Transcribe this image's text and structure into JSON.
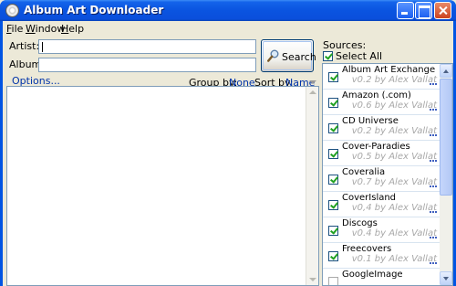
{
  "window": {
    "title": "Album Art Downloader"
  },
  "menu": {
    "file": "File",
    "window": "Window",
    "help": "Help"
  },
  "search": {
    "artist_label": "Artist:",
    "album_label": "Album:",
    "artist_value": "",
    "album_value": "",
    "button_label": "Search"
  },
  "results_bar": {
    "options_link": "Options...",
    "group_by_label": "Group by:",
    "group_by_value": "None",
    "sort_by_label": "Sort by:",
    "sort_by_value": "Name"
  },
  "sources": {
    "label": "Sources:",
    "select_all_label": "Select All",
    "select_all_checked": true,
    "items": [
      {
        "name": "Album Art Exchange",
        "version": "v0.2 by Alex Vallat",
        "checked": true
      },
      {
        "name": "Amazon (.com)",
        "version": "v0.6 by Alex Vallat",
        "checked": true
      },
      {
        "name": "CD Universe",
        "version": "v0.2 by Alex Vallat",
        "checked": true
      },
      {
        "name": "Cover-Paradies",
        "version": "v0.5 by Alex Vallat",
        "checked": true
      },
      {
        "name": "Coveralia",
        "version": "v0.7 by Alex Vallat",
        "checked": true
      },
      {
        "name": "CoverIsland",
        "version": "v0,4 by Alex Vallat",
        "checked": true
      },
      {
        "name": "Discogs",
        "version": "v0.4 by Alex Vallat",
        "checked": true
      },
      {
        "name": "Freecovers",
        "version": "v0.1 by Alex Vallat",
        "checked": true
      },
      {
        "name": "GoogleImage",
        "version": "",
        "checked": false
      }
    ]
  },
  "colors": {
    "title_bar": "#0a54e0",
    "link": "#0033aa",
    "face": "#ece9d8"
  }
}
